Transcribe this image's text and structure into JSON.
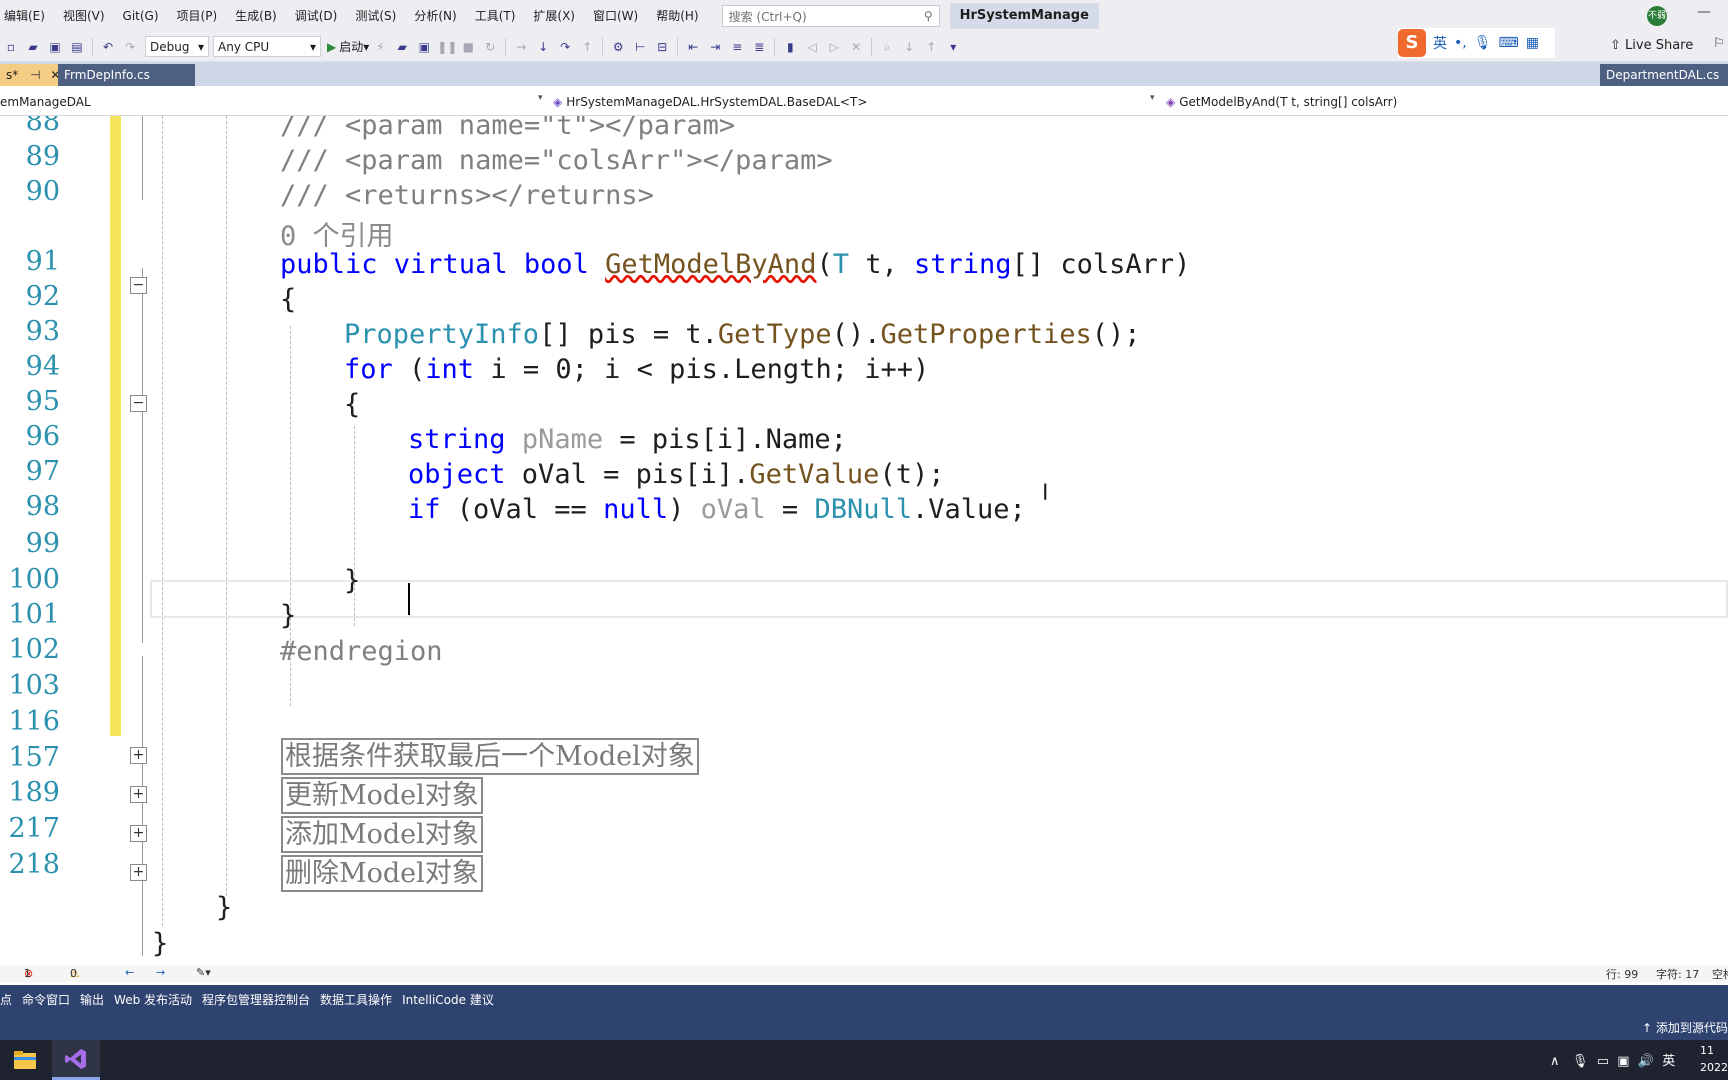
{
  "menubar": {
    "items": [
      "编辑(E)",
      "视图(V)",
      "Git(G)",
      "项目(P)",
      "生成(B)",
      "调试(D)",
      "测试(S)",
      "分析(N)",
      "工具(T)",
      "扩展(X)",
      "窗口(W)",
      "帮助(H)"
    ],
    "search_placeholder": "搜索 (Ctrl+Q)",
    "solution_title": "HrSystemManage",
    "avatar_text": "不弱"
  },
  "toolbar": {
    "configuration": "Debug",
    "platform": "Any CPU",
    "start_label": "启动",
    "ime_mode": "英",
    "live_share": "Live Share"
  },
  "tabs": {
    "active_label": "s*",
    "second_label": "FrmDepInfo.cs",
    "right_label": "DepartmentDAL.cs"
  },
  "navbar": {
    "project": "emManageDAL",
    "class": "HrSystemManageDAL.HrSystemDAL.BaseDAL<T>",
    "member": "GetModelByAnd(T t, string[] colsArr)"
  },
  "editor": {
    "line_numbers": [
      "88",
      "89",
      "90",
      "91",
      "92",
      "93",
      "94",
      "95",
      "96",
      "97",
      "98",
      "99",
      "100",
      "101",
      "102",
      "103",
      "116",
      "157",
      "189",
      "217",
      "218"
    ],
    "reference_count": "0 个引用",
    "regions": [
      "根据条件获取最后一个Model对象",
      "更新Model对象",
      "添加Model对象",
      "删除Model对象"
    ]
  },
  "status": {
    "errors": "1",
    "warnings": "0",
    "line": "行: 99",
    "char": "字符: 17",
    "space": "空格"
  },
  "panels": [
    "断点",
    "命令窗口",
    "输出",
    "Web 发布活动",
    "程序包管理器控制台",
    "数据工具操作",
    "IntelliCode 建议"
  ],
  "statusbar": {
    "add_source": "添加到源代码"
  },
  "taskbar": {
    "ime": "英",
    "clock_top": "11",
    "clock_bottom": "2022"
  }
}
